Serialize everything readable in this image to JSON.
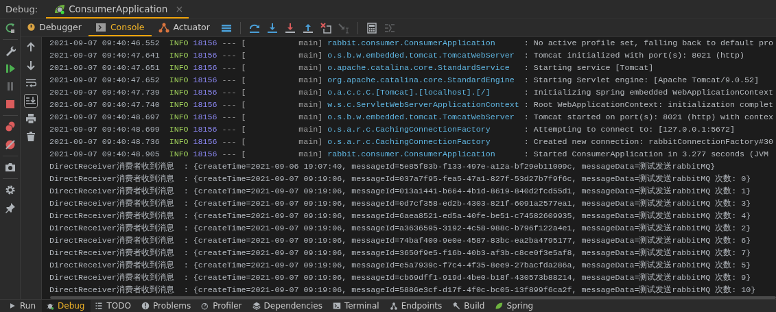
{
  "header": {
    "label": "Debug:",
    "session_tab": {
      "title": "ConsumerApplication",
      "close": "×",
      "selected": true
    }
  },
  "side_buttons": [
    {
      "kind": "rerun",
      "disabled": false
    },
    {
      "kind": "wrench",
      "disabled": false
    },
    {
      "kind": "resume",
      "disabled": false
    },
    {
      "kind": "pause",
      "disabled": true
    },
    {
      "kind": "stop",
      "disabled": false
    },
    {
      "kind": "breakpoints",
      "disabled": false
    },
    {
      "kind": "mute",
      "disabled": false
    },
    {
      "kind": "camera",
      "disabled": false
    },
    {
      "kind": "settings",
      "disabled": false
    },
    {
      "kind": "pin",
      "disabled": false
    }
  ],
  "view_tabs": [
    {
      "label": "Debugger",
      "kind": "debugger",
      "selected": false
    },
    {
      "label": "Console",
      "kind": "console",
      "selected": true
    },
    {
      "label": "Actuator",
      "kind": "actuator",
      "selected": false
    }
  ],
  "toolbar_buttons": [
    {
      "kind": "menu",
      "disabled": false
    },
    {
      "kind": "step-over",
      "disabled": false
    },
    {
      "kind": "step-into",
      "disabled": false
    },
    {
      "kind": "force-step-into",
      "disabled": false
    },
    {
      "kind": "step-out",
      "disabled": false
    },
    {
      "kind": "drop-frame",
      "disabled": false
    },
    {
      "kind": "run-to-cursor",
      "disabled": true
    },
    {
      "kind": "evaluate",
      "disabled": false
    },
    {
      "kind": "trace",
      "disabled": true
    }
  ],
  "console_tools": [
    {
      "kind": "up",
      "selected": false
    },
    {
      "kind": "down",
      "selected": false
    },
    {
      "kind": "wrap",
      "selected": false
    },
    {
      "kind": "scroll-end",
      "selected": true
    },
    {
      "kind": "print",
      "selected": false
    },
    {
      "kind": "delete",
      "selected": false
    }
  ],
  "console": {
    "log_lines": [
      {
        "timestamp": "2021-09-07 09:40:46.552",
        "level": "INFO",
        "pid": "18156",
        "separator": "---",
        "thread": "[           main]",
        "logger": "rabbit.consumer.ConsumerApplication",
        "message": ": No active profile set, falling back to default pro"
      },
      {
        "timestamp": "2021-09-07 09:40:47.641",
        "level": "INFO",
        "pid": "18156",
        "separator": "---",
        "thread": "[           main]",
        "logger": "o.s.b.w.embedded.tomcat.TomcatWebServer",
        "message": ": Tomcat initialized with port(s): 8021 (http)"
      },
      {
        "timestamp": "2021-09-07 09:40:47.651",
        "level": "INFO",
        "pid": "18156",
        "separator": "---",
        "thread": "[           main]",
        "logger": "o.apache.catalina.core.StandardService",
        "message": ": Starting service [Tomcat]"
      },
      {
        "timestamp": "2021-09-07 09:40:47.652",
        "level": "INFO",
        "pid": "18156",
        "separator": "---",
        "thread": "[           main]",
        "logger": "org.apache.catalina.core.StandardEngine",
        "message": ": Starting Servlet engine: [Apache Tomcat/9.0.52]"
      },
      {
        "timestamp": "2021-09-07 09:40:47.739",
        "level": "INFO",
        "pid": "18156",
        "separator": "---",
        "thread": "[           main]",
        "logger": "o.a.c.c.C.[Tomcat].[localhost].[/]",
        "message": ": Initializing Spring embedded WebApplicationContext"
      },
      {
        "timestamp": "2021-09-07 09:40:47.740",
        "level": "INFO",
        "pid": "18156",
        "separator": "---",
        "thread": "[           main]",
        "logger": "w.s.c.ServletWebServerApplicationContext",
        "message": ": Root WebApplicationContext: initialization complet"
      },
      {
        "timestamp": "2021-09-07 09:40:48.697",
        "level": "INFO",
        "pid": "18156",
        "separator": "---",
        "thread": "[           main]",
        "logger": "o.s.b.w.embedded.tomcat.TomcatWebServer",
        "message": ": Tomcat started on port(s): 8021 (http) with contex"
      },
      {
        "timestamp": "2021-09-07 09:40:48.699",
        "level": "INFO",
        "pid": "18156",
        "separator": "---",
        "thread": "[           main]",
        "logger": "o.s.a.r.c.CachingConnectionFactory",
        "message": ": Attempting to connect to: [127.0.0.1:5672]"
      },
      {
        "timestamp": "2021-09-07 09:40:48.736",
        "level": "INFO",
        "pid": "18156",
        "separator": "---",
        "thread": "[           main]",
        "logger": "o.s.a.r.c.CachingConnectionFactory",
        "message": ": Created new connection: rabbitConnectionFactory#30"
      },
      {
        "timestamp": "2021-09-07 09:40:48.905",
        "level": "INFO",
        "pid": "18156",
        "separator": "---",
        "thread": "[           main]",
        "logger": "rabbit.consumer.ConsumerApplication",
        "message": ": Started ConsumerApplication in 3.277 seconds (JVM"
      }
    ],
    "receiver_lines": [
      "DirectReceiver消费者收到消息  : {createTime=2021-09-06 19:07:40, messageId=5e85f83b-f133-497e-a12a-bf29eb11009c, messageData=测试发送rabbitMQ}",
      "DirectReceiver消费者收到消息  : {createTime=2021-09-07 09:19:06, messageId=037a7f95-fea5-47a1-827f-53d27b7f9f6c, messageData=测试发送rabbitMQ 次数: 0}",
      "DirectReceiver消费者收到消息  : {createTime=2021-09-07 09:19:06, messageId=013a1441-b664-4b1d-8619-840d2fcd55d1, messageData=测试发送rabbitMQ 次数: 1}",
      "DirectReceiver消费者收到消息  : {createTime=2021-09-07 09:19:06, messageId=0d7cf358-ed2b-4303-821f-6091a2577ea1, messageData=测试发送rabbitMQ 次数: 3}",
      "DirectReceiver消费者收到消息  : {createTime=2021-09-07 09:19:06, messageId=6aea8521-ed5a-40fe-be51-c74582609935, messageData=测试发送rabbitMQ 次数: 4}",
      "DirectReceiver消费者收到消息  : {createTime=2021-09-07 09:19:06, messageId=a3636595-3192-4c58-988c-b796f122a4e1, messageData=测试发送rabbitMQ 次数: 2}",
      "DirectReceiver消费者收到消息  : {createTime=2021-09-07 09:19:06, messageId=74baf400-9e0e-4587-83bc-ea2ba4795177, messageData=测试发送rabbitMQ 次数: 6}",
      "DirectReceiver消费者收到消息  : {createTime=2021-09-07 09:19:06, messageId=3650f9e5-f16b-40b3-af3b-c8ce0f3e5af8, messageData=测试发送rabbitMQ 次数: 7}",
      "DirectReceiver消费者收到消息  : {createTime=2021-09-07 09:19:06, messageId=e5a7939c-f7c4-4f35-8ee9-27bacfda286a, messageData=测试发送rabbitMQ 次数: 5}",
      "DirectReceiver消费者收到消息  : {createTime=2021-09-07 09:19:06, messageId=cb69dff1-919d-4be0-b18f-430573b88214, messageData=测试发送rabbitMQ 次数: 9}",
      "DirectReceiver消费者收到消息  : {createTime=2021-09-07 09:19:06, messageId=5886e3cf-d17f-4f0c-bc05-13f899f6ca2f, messageData=测试发送rabbitMQ 次数: 10}"
    ]
  },
  "tool_windows": [
    {
      "label": "Run",
      "kind": "run",
      "selected": false
    },
    {
      "label": "Debug",
      "kind": "debug",
      "selected": true
    },
    {
      "label": "TODO",
      "kind": "todo",
      "selected": false
    },
    {
      "label": "Problems",
      "kind": "problems",
      "selected": false
    },
    {
      "label": "Profiler",
      "kind": "profiler",
      "selected": false
    },
    {
      "label": "Dependencies",
      "kind": "dependencies",
      "selected": false
    },
    {
      "label": "Terminal",
      "kind": "terminal",
      "selected": false
    },
    {
      "label": "Endpoints",
      "kind": "endpoints",
      "selected": false
    },
    {
      "label": "Build",
      "kind": "build",
      "selected": false
    },
    {
      "label": "Spring",
      "kind": "spring",
      "selected": false
    }
  ]
}
